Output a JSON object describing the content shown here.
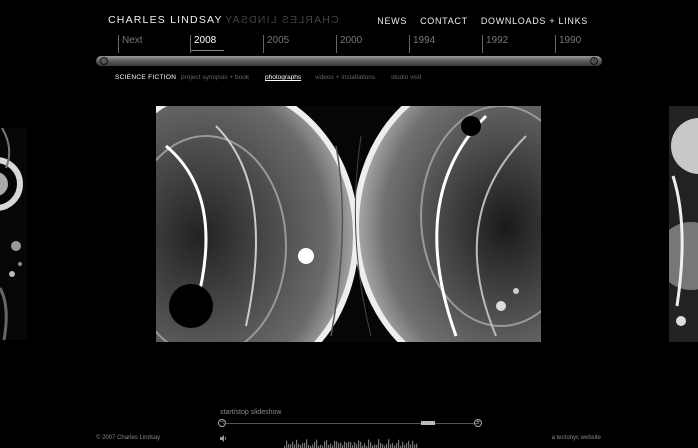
{
  "header": {
    "logo_text": "CHARLES LINDSAY",
    "nav": [
      "NEWS",
      "CONTACT",
      "DOWNLOADS + LINKS"
    ]
  },
  "timeline": {
    "labels": [
      "Next",
      "2008",
      "2005",
      "2000",
      "1994",
      "1992",
      "1990"
    ],
    "active": "2008"
  },
  "subnav": {
    "section": "SCIENCE FICTION",
    "links": [
      "project synopsis + book",
      "photographs",
      "videos + installations",
      "studio visit"
    ],
    "current": "photographs"
  },
  "slideshow": {
    "label": "start/stop slideshow",
    "position": 0.82
  },
  "footer": {
    "copyright": "© 2007 Charles Lindsay",
    "credit": "a tectonyc website"
  },
  "icons": [
    "zoom-out-icon",
    "zoom-in-icon",
    "speaker-icon",
    "waveform-icon"
  ],
  "colors": {
    "background": "#000000",
    "text": "#ffffff",
    "muted": "#777777"
  }
}
